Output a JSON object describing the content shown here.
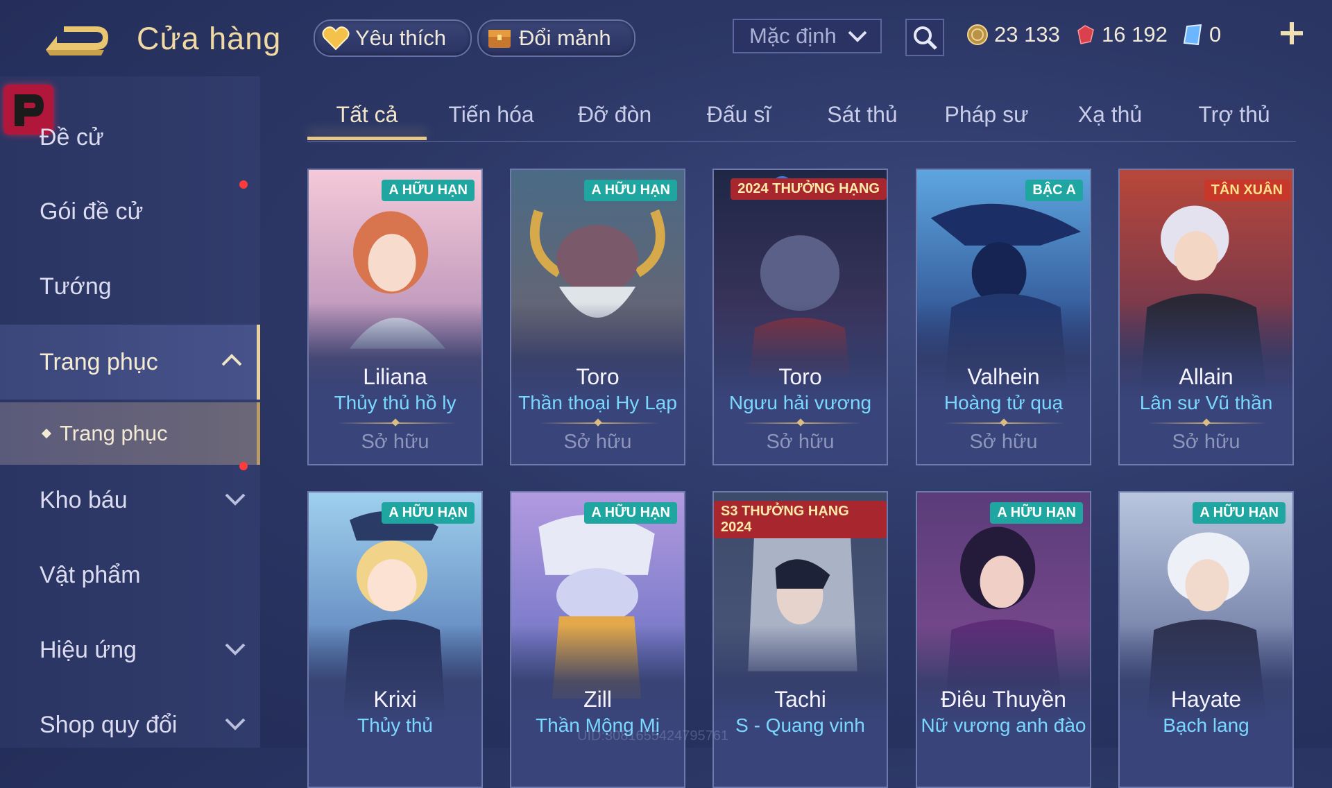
{
  "header": {
    "title": "Cửa hàng",
    "favorite_label": "Yêu thích",
    "fragment_label": "Đổi mảnh",
    "sort_value": "Mặc định",
    "currencies": {
      "coin": "23 133",
      "gem": "16 192",
      "voucher": "0"
    }
  },
  "sidebar": {
    "items": [
      {
        "label": "Đề cử"
      },
      {
        "label": "Gói đề cử"
      },
      {
        "label": "Tướng"
      },
      {
        "label": "Trang phục"
      },
      {
        "label": "Trang phục"
      },
      {
        "label": "Kho báu"
      },
      {
        "label": "Vật phẩm"
      },
      {
        "label": "Hiệu ứng"
      },
      {
        "label": "Shop quy đổi"
      }
    ]
  },
  "tabs": [
    {
      "label": "Tất cả"
    },
    {
      "label": "Tiến hóa"
    },
    {
      "label": "Đỡ đòn"
    },
    {
      "label": "Đấu sĩ"
    },
    {
      "label": "Sát thủ"
    },
    {
      "label": "Pháp sư"
    },
    {
      "label": "Xạ thủ"
    },
    {
      "label": "Trợ thủ"
    }
  ],
  "cards": [
    {
      "hero": "Liliana",
      "skin": "Thủy thủ hồ ly",
      "status": "Sở hữu",
      "badge": "A HỮU HẠN",
      "accent": "#e79a86"
    },
    {
      "hero": "Toro",
      "skin": "Thần thoại Hy Lạp",
      "status": "Sở hữu",
      "badge": "A HỮU HẠN",
      "accent": "#a9b0a3"
    },
    {
      "hero": "Toro",
      "skin": "Ngưu hải vương",
      "status": "Sở hữu",
      "badge": "2024 THƯỞNG HẠNG",
      "accent": "#5a4a7a"
    },
    {
      "hero": "Valhein",
      "skin": "Hoàng tử quạ",
      "status": "Sở hữu",
      "badge": "BẬC A",
      "accent": "#2f5a8e"
    },
    {
      "hero": "Allain",
      "skin": "Lân sư Vũ thần",
      "status": "Sở hữu",
      "badge": "TÂN XUÂN",
      "accent": "#9c3a3a"
    },
    {
      "hero": "Krixi",
      "skin": "Thủy thủ",
      "status": "",
      "badge": "A HỮU HẠN",
      "accent": "#7fb4d8"
    },
    {
      "hero": "Zill",
      "skin": "Thần Mộng Mị",
      "status": "",
      "badge": "A HỮU HẠN",
      "accent": "#8e9ad6"
    },
    {
      "hero": "Tachi",
      "skin": "S - Quang vinh",
      "status": "",
      "badge": "S3 THƯỞNG HẠNG 2024",
      "accent": "#4a5a80"
    },
    {
      "hero": "Điêu Thuyền",
      "skin": "Nữ vương anh đào",
      "status": "",
      "badge": "A HỮU HẠN",
      "accent": "#8a4a8e"
    },
    {
      "hero": "Hayate",
      "skin": "Bạch lang",
      "status": "",
      "badge": "A HỮU HẠN",
      "accent": "#7c89a8"
    }
  ],
  "watermark": "UID:3081655424795761"
}
